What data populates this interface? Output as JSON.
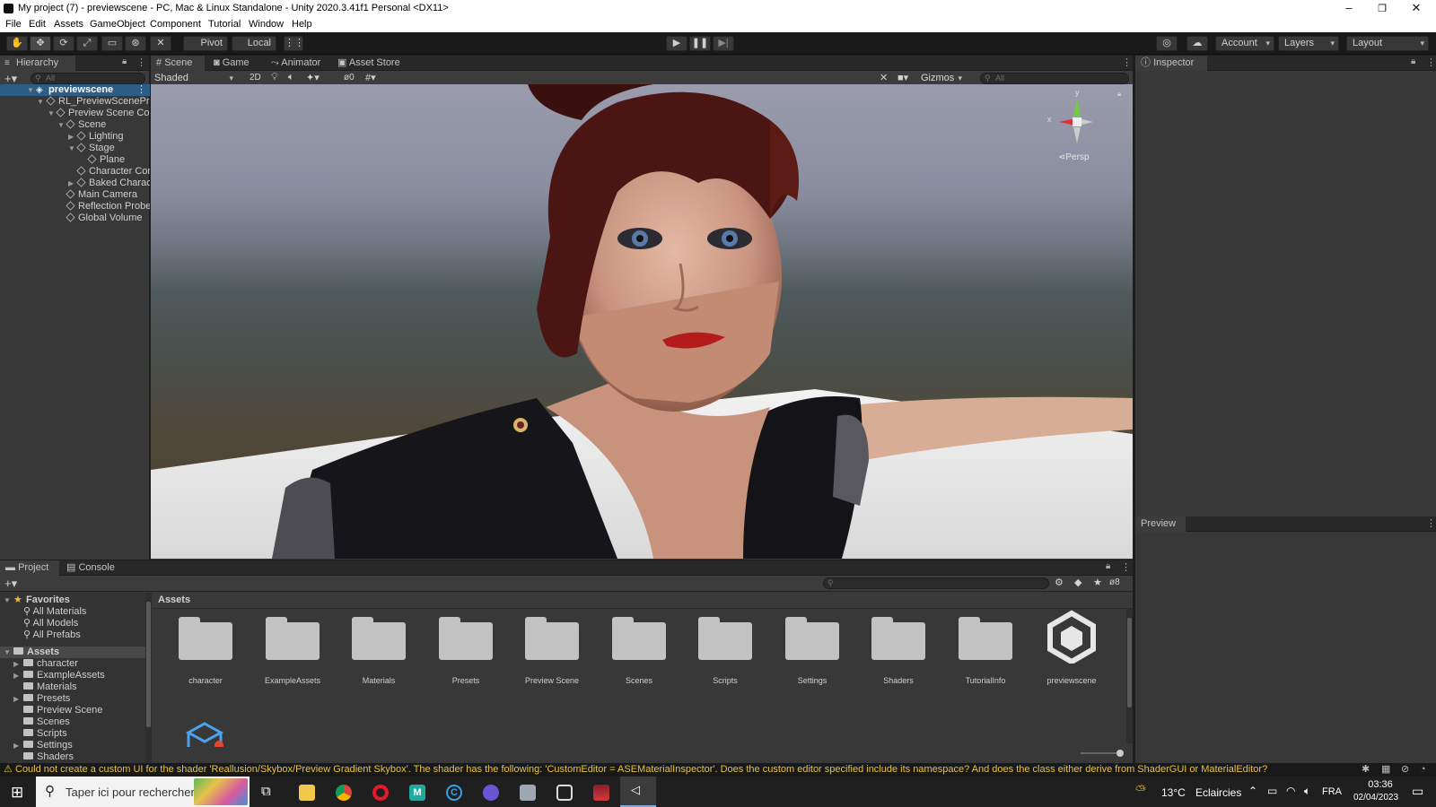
{
  "window": {
    "title": "My project (7) - previewscene - PC, Mac & Linux Standalone - Unity 2020.3.41f1 Personal <DX11>"
  },
  "menu": [
    "File",
    "Edit",
    "Assets",
    "GameObject",
    "Component",
    "Tutorial",
    "Window",
    "Help"
  ],
  "toolbar": {
    "pivot_label": "Pivot",
    "local_label": "Local",
    "account_label": "Account",
    "layers_label": "Layers",
    "layout_label": "Layout"
  },
  "hierarchy": {
    "tab_label": "Hierarchy",
    "search_placeholder": "All",
    "root": "previewscene",
    "items": [
      "RL_PreviewScenePre",
      "Preview Scene Cor",
      "Scene",
      "Lighting",
      "Stage",
      "Plane",
      "Character Cor",
      "Baked Charac",
      "Main Camera",
      "Reflection Probe",
      "Global Volume"
    ]
  },
  "scene": {
    "tabs": [
      "Scene",
      "Game",
      "Animator",
      "Asset Store"
    ],
    "shading_mode": "Shaded",
    "mode_2d": "2D",
    "hidden_count": "0",
    "gizmos_label": "Gizmos",
    "search_placeholder": "All",
    "axis_x": "x",
    "axis_y": "y",
    "persp_label": "Persp"
  },
  "inspector": {
    "tab_label": "Inspector",
    "preview_label": "Preview"
  },
  "project": {
    "tabs": [
      "Project",
      "Console"
    ],
    "favorites_label": "Favorites",
    "favorites": [
      "All Materials",
      "All Models",
      "All Prefabs"
    ],
    "assets_root_label": "Assets",
    "tree_items": [
      "character",
      "ExampleAssets",
      "Materials",
      "Presets",
      "Preview Scene",
      "Scenes",
      "Scripts",
      "Settings",
      "Shaders"
    ],
    "breadcrumb": "Assets",
    "hidden_count": "8",
    "assets": [
      "character",
      "ExampleAssets",
      "Materials",
      "Presets",
      "Preview Scene",
      "Scenes",
      "Scripts",
      "Settings",
      "Shaders",
      "TutorialInfo",
      "previewscene"
    ]
  },
  "status": {
    "message": "Could not create a custom UI for the shader 'Reallusion/Skybox/Preview Gradient Skybox'. The shader has the following: 'CustomEditor = ASEMaterialInspector'. Does the custom editor specified include its namespace? And does the class either derive from ShaderGUI or MaterialEditor?"
  },
  "taskbar": {
    "search_placeholder": "Taper ici pour rechercher",
    "weather_temp": "13°C",
    "weather_text": "Eclaircies",
    "language": "FRA",
    "time": "03:36",
    "date": "02/04/2023"
  },
  "colors": {
    "status_warning": "#e8c23e",
    "accent_blue": "#2c5d87",
    "editor_bg": "#383838"
  }
}
